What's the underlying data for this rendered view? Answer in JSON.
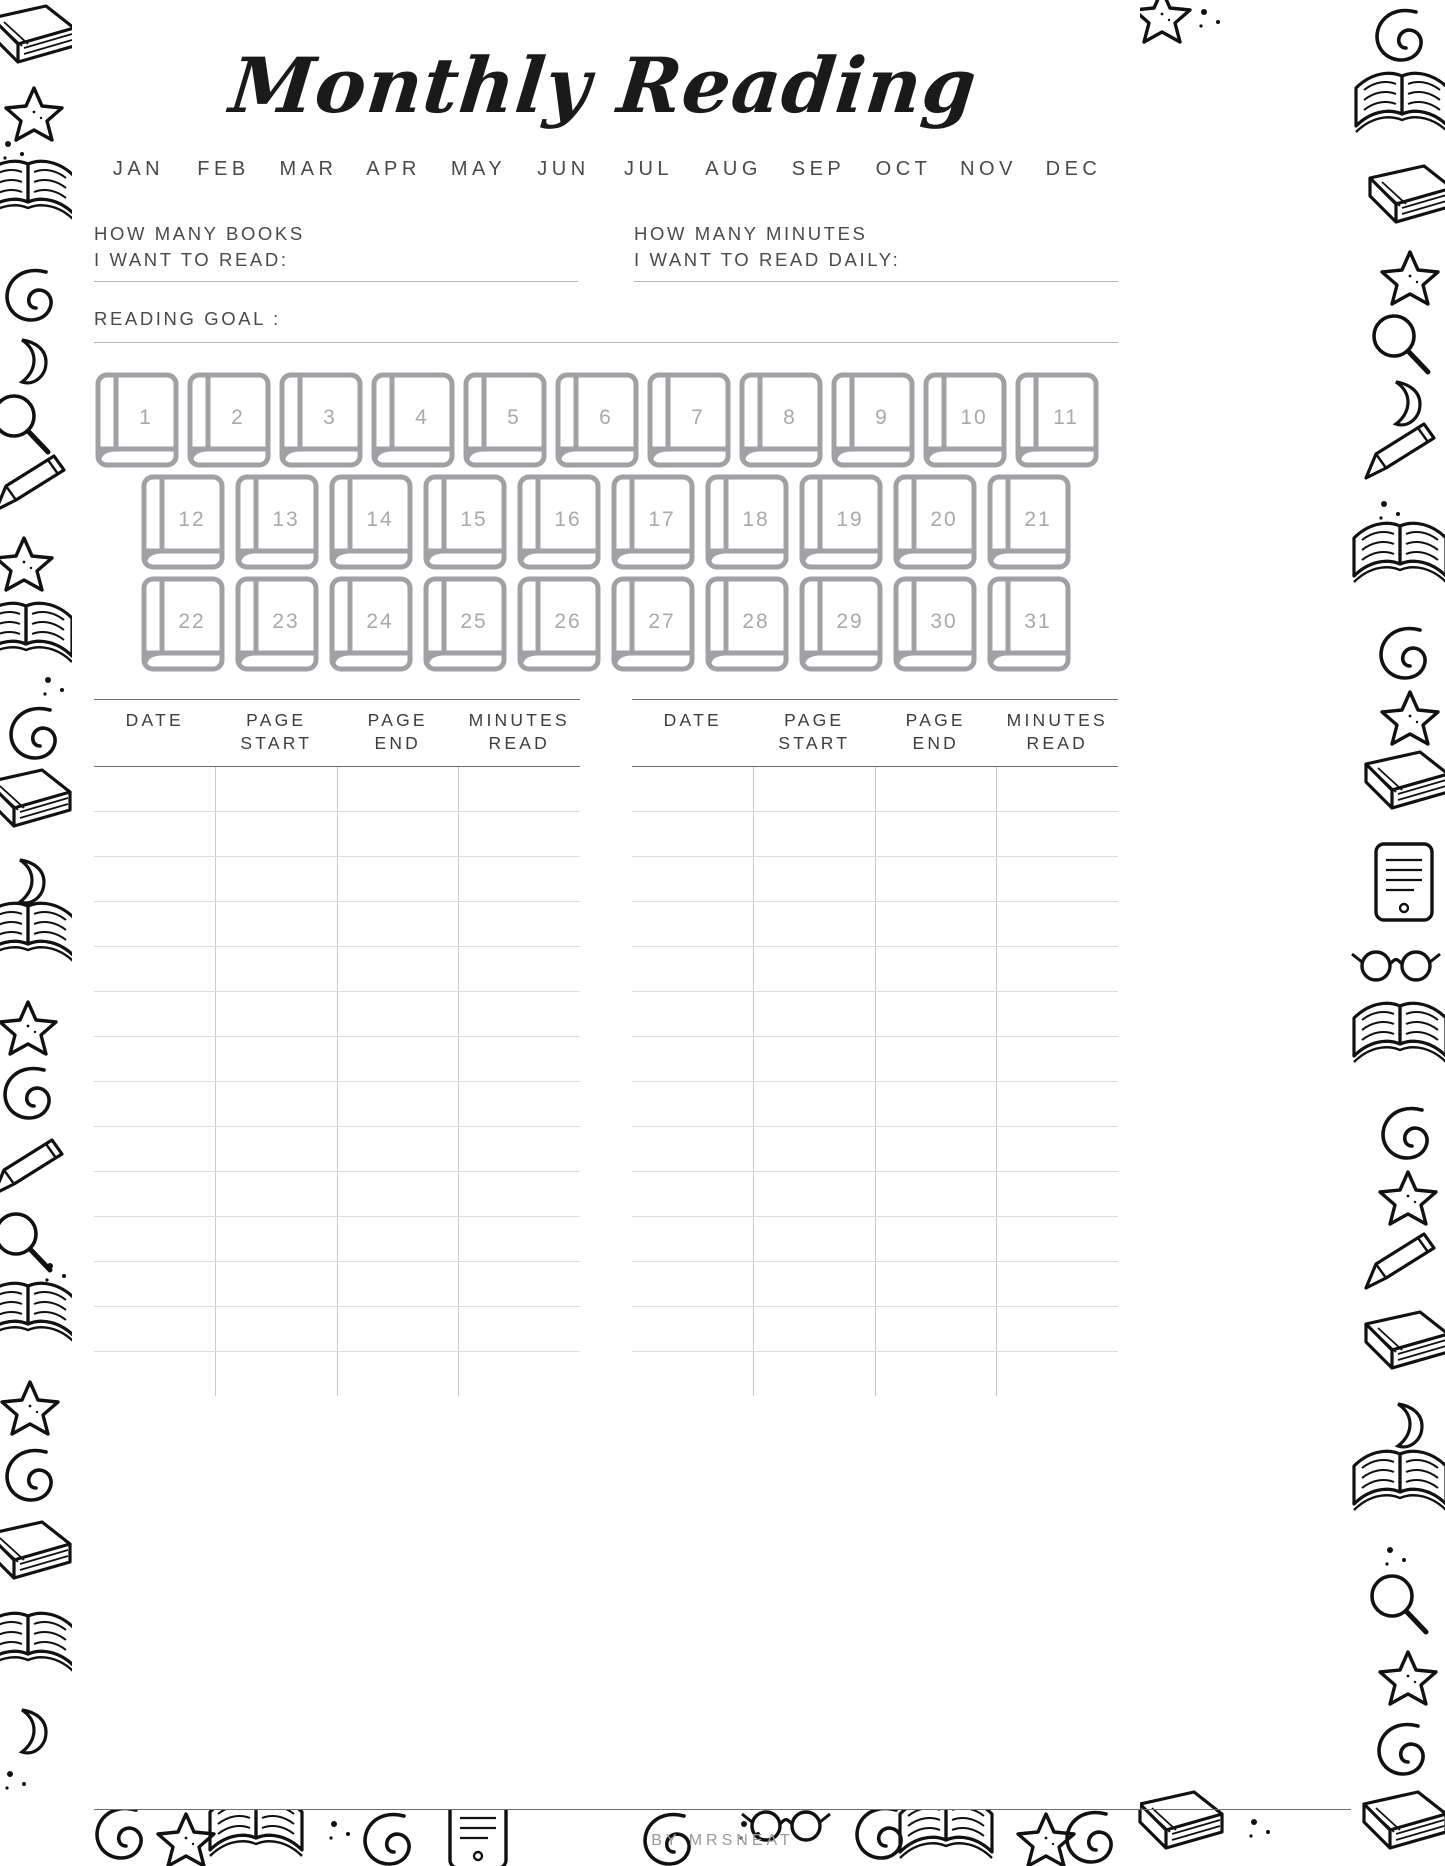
{
  "page": {
    "title": "Monthly Reading",
    "credit": "BY MRSNEAT"
  },
  "months": [
    {
      "label": "JAN"
    },
    {
      "label": "FEB"
    },
    {
      "label": "MAR"
    },
    {
      "label": "APR"
    },
    {
      "label": "MAY"
    },
    {
      "label": "JUN"
    },
    {
      "label": "JUL"
    },
    {
      "label": "AUG"
    },
    {
      "label": "SEP"
    },
    {
      "label": "OCT"
    },
    {
      "label": "NOV"
    },
    {
      "label": "DEC"
    }
  ],
  "goals": {
    "books": {
      "line1": "HOW MANY BOOKS",
      "line2": "I WANT TO READ:"
    },
    "minutes": {
      "line1": "HOW MANY MINUTES",
      "line2": "I WANT TO READ DAILY:"
    },
    "reading_goal": {
      "label": "READING GOAL :"
    }
  },
  "book_tracker": {
    "rows": [
      {
        "numbers": [
          "1",
          "2",
          "3",
          "4",
          "5",
          "6",
          "7",
          "8",
          "9",
          "10",
          "11"
        ]
      },
      {
        "numbers": [
          "12",
          "13",
          "14",
          "15",
          "16",
          "17",
          "18",
          "19",
          "20",
          "21"
        ]
      },
      {
        "numbers": [
          "22",
          "23",
          "24",
          "25",
          "26",
          "27",
          "28",
          "29",
          "30",
          "31"
        ]
      }
    ]
  },
  "log_tables": [
    {
      "id": "left",
      "headers": [
        {
          "line1": "DATE",
          "line2": ""
        },
        {
          "line1": "PAGE",
          "line2": "START"
        },
        {
          "line1": "PAGE",
          "line2": "END"
        },
        {
          "line1": "MINUTES",
          "line2": "READ"
        }
      ],
      "row_count": 14,
      "rows": [
        {
          "date": "",
          "page_start": "",
          "page_end": "",
          "minutes_read": ""
        },
        {
          "date": "",
          "page_start": "",
          "page_end": "",
          "minutes_read": ""
        },
        {
          "date": "",
          "page_start": "",
          "page_end": "",
          "minutes_read": ""
        },
        {
          "date": "",
          "page_start": "",
          "page_end": "",
          "minutes_read": ""
        },
        {
          "date": "",
          "page_start": "",
          "page_end": "",
          "minutes_read": ""
        },
        {
          "date": "",
          "page_start": "",
          "page_end": "",
          "minutes_read": ""
        },
        {
          "date": "",
          "page_start": "",
          "page_end": "",
          "minutes_read": ""
        },
        {
          "date": "",
          "page_start": "",
          "page_end": "",
          "minutes_read": ""
        },
        {
          "date": "",
          "page_start": "",
          "page_end": "",
          "minutes_read": ""
        },
        {
          "date": "",
          "page_start": "",
          "page_end": "",
          "minutes_read": ""
        },
        {
          "date": "",
          "page_start": "",
          "page_end": "",
          "minutes_read": ""
        },
        {
          "date": "",
          "page_start": "",
          "page_end": "",
          "minutes_read": ""
        },
        {
          "date": "",
          "page_start": "",
          "page_end": "",
          "minutes_read": ""
        },
        {
          "date": "",
          "page_start": "",
          "page_end": "",
          "minutes_read": ""
        }
      ]
    },
    {
      "id": "right",
      "headers": [
        {
          "line1": "DATE",
          "line2": ""
        },
        {
          "line1": "PAGE",
          "line2": "START"
        },
        {
          "line1": "PAGE",
          "line2": "END"
        },
        {
          "line1": "MINUTES",
          "line2": "READ"
        }
      ],
      "row_count": 14,
      "rows": [
        {
          "date": "",
          "page_start": "",
          "page_end": "",
          "minutes_read": ""
        },
        {
          "date": "",
          "page_start": "",
          "page_end": "",
          "minutes_read": ""
        },
        {
          "date": "",
          "page_start": "",
          "page_end": "",
          "minutes_read": ""
        },
        {
          "date": "",
          "page_start": "",
          "page_end": "",
          "minutes_read": ""
        },
        {
          "date": "",
          "page_start": "",
          "page_end": "",
          "minutes_read": ""
        },
        {
          "date": "",
          "page_start": "",
          "page_end": "",
          "minutes_read": ""
        },
        {
          "date": "",
          "page_start": "",
          "page_end": "",
          "minutes_read": ""
        },
        {
          "date": "",
          "page_start": "",
          "page_end": "",
          "minutes_read": ""
        },
        {
          "date": "",
          "page_start": "",
          "page_end": "",
          "minutes_read": ""
        },
        {
          "date": "",
          "page_start": "",
          "page_end": "",
          "minutes_read": ""
        },
        {
          "date": "",
          "page_start": "",
          "page_end": "",
          "minutes_read": ""
        },
        {
          "date": "",
          "page_start": "",
          "page_end": "",
          "minutes_read": ""
        },
        {
          "date": "",
          "page_start": "",
          "page_end": "",
          "minutes_read": ""
        },
        {
          "date": "",
          "page_start": "",
          "page_end": "",
          "minutes_read": ""
        }
      ]
    }
  ],
  "colors": {
    "ink": "#1a1a1a",
    "label_gray": "#4a4a4a",
    "book_outline": "#a0a0a5",
    "book_number": "#a8a8ad",
    "rule_dark": "#6e6e6e",
    "rule_light": "#dcdcdc",
    "credit_gray": "#9a9a9a"
  },
  "decor": {
    "theme": "doodle-border",
    "motifs": [
      "open-book-icon",
      "closed-book-icon",
      "star-icon",
      "swirl-icon",
      "magnifier-icon",
      "pencil-icon",
      "glasses-icon",
      "tablet-icon",
      "dot-icon",
      "paperclip-icon"
    ]
  }
}
